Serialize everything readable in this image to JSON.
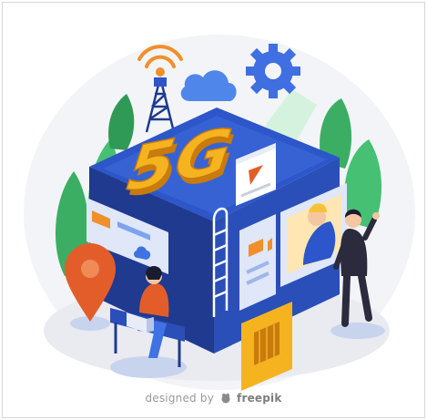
{
  "illustration": {
    "headline": "5G",
    "credit_prefix": "designed by",
    "credit_brand": "freepik",
    "colors": {
      "background": "#f4f5f7",
      "cube_dark": "#1f3a8f",
      "cube_mid": "#2c56c9",
      "cube_light": "#3f72e2",
      "gold": "#f5b320",
      "gold_dark": "#c97b0d",
      "tree": "#3cae63",
      "pin": "#e35d2a",
      "gear": "#3f6fe0",
      "wifi": "#f0902a"
    },
    "icons": [
      "wifi-icon",
      "antenna-icon",
      "cloud-icon",
      "gear-icon",
      "play-icon",
      "camera-icon",
      "map-pin-icon",
      "sim-card-icon"
    ]
  }
}
